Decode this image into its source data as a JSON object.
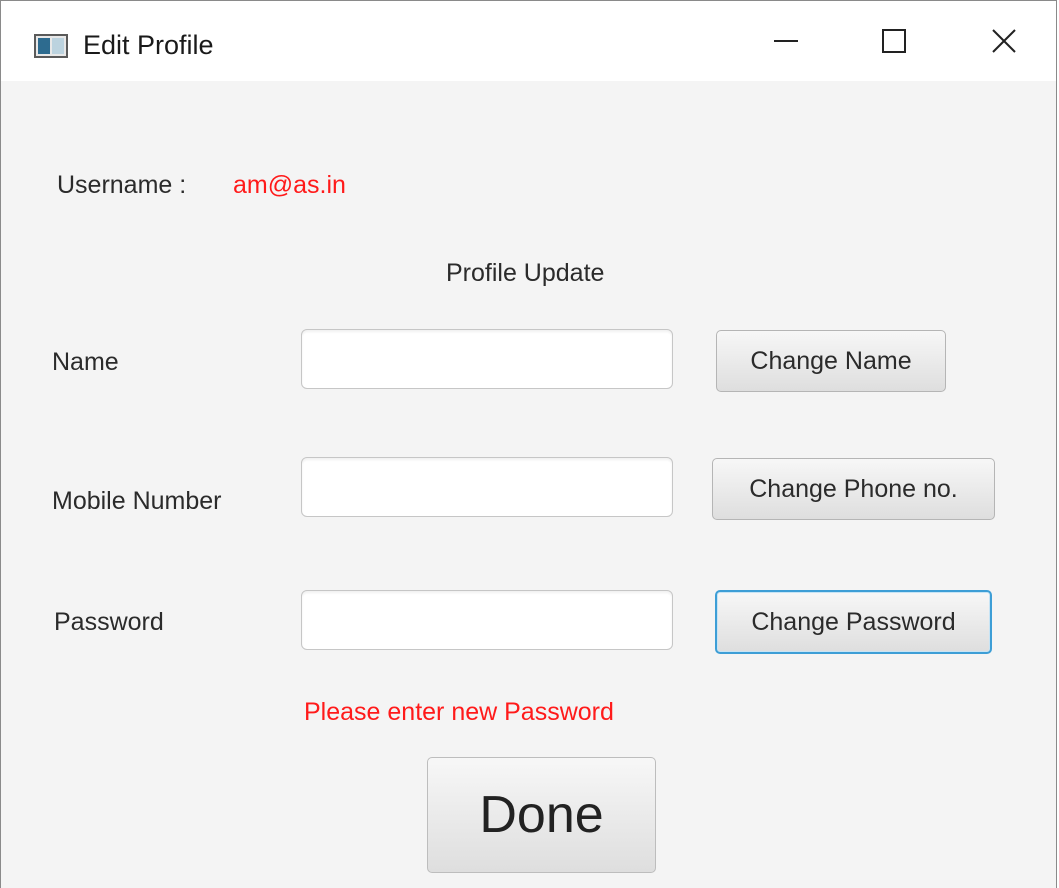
{
  "window": {
    "title": "Edit Profile"
  },
  "header": {
    "username_label": "Username :",
    "username_value": "am@as.in",
    "section_title": "Profile Update"
  },
  "form": {
    "name_label": "Name",
    "name_value": "",
    "change_name_button": "Change Name",
    "mobile_label": "Mobile Number",
    "mobile_value": "",
    "change_phone_button": "Change Phone no.",
    "password_label": "Password",
    "password_value": "",
    "change_password_button": "Change Password",
    "message": "Please enter new Password",
    "done_button": "Done"
  },
  "colors": {
    "accent_red": "#ff1a1a",
    "focus_blue": "#3d9ed6",
    "window_bg": "#f4f4f4"
  },
  "icons": {
    "app": "app-window-icon",
    "minimize": "minimize-icon",
    "maximize": "maximize-icon",
    "close": "close-icon"
  }
}
